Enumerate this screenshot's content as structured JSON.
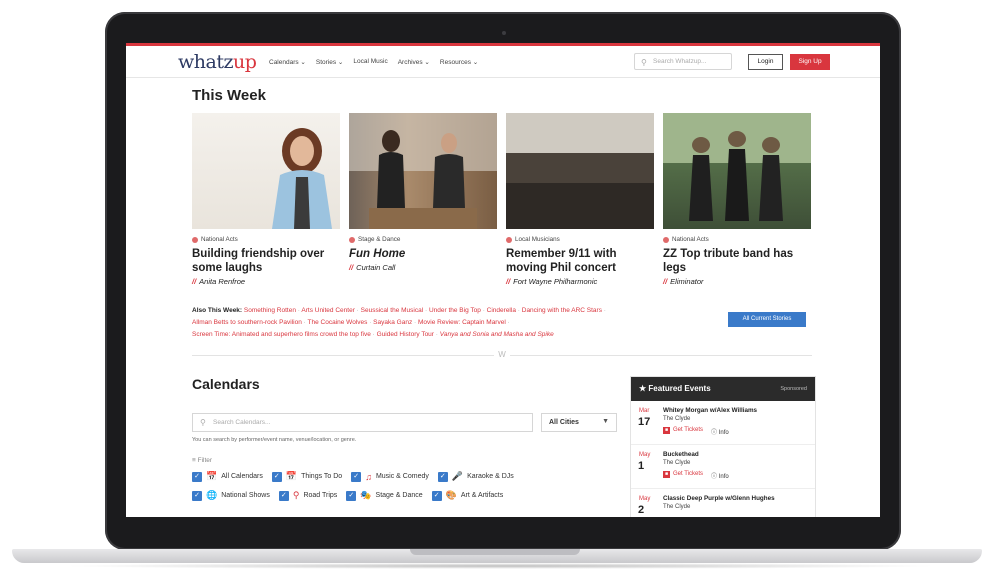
{
  "header": {
    "logo_main": "whatz",
    "logo_accent": "up",
    "nav": [
      "Calendars ⌄",
      "Stories ⌄",
      "Local Music",
      "Archives ⌄",
      "Resources ⌄"
    ],
    "search_placeholder": "Search Whatzup...",
    "login": "Login",
    "signup": "Sign Up"
  },
  "this_week": {
    "heading": "This Week",
    "cards": [
      {
        "category": "National Acts",
        "title": "Building friendship over some laughs",
        "subtitle": "Anita Renfroe",
        "italic": false
      },
      {
        "category": "Stage & Dance",
        "title": "Fun Home",
        "subtitle": "Curtain Call",
        "italic": true
      },
      {
        "category": "Local Musicians",
        "title": "Remember 9/11 with moving Phil concert",
        "subtitle": "Fort Wayne Philharmonic",
        "italic": false
      },
      {
        "category": "National Acts",
        "title": "ZZ Top tribute band has legs",
        "subtitle": "Eliminator",
        "italic": false
      }
    ]
  },
  "also": {
    "label": "Also This Week:",
    "line1": [
      "Something Rotten",
      "Arts United Center",
      "Seussical the Musical",
      "Under the Big Top",
      "Cinderella",
      "Dancing with the ARC Stars"
    ],
    "line2": [
      "Allman Betts to southern-rock Pavilion",
      "The Cocaine Wolves",
      "Sayaka Ganz",
      "Movie Review: Captain Marvel"
    ],
    "line3": [
      "Screen Time: Animated and superhero films crowd the top five",
      "Guided History Tour",
      "Vanya and Sonia and Masha and Spike"
    ],
    "button": "All Current Stories"
  },
  "divider_mark": "W",
  "calendars": {
    "heading": "Calendars",
    "search_placeholder": "Search Calendars...",
    "cities": "All Cities",
    "hint": "You can search by performer/event name, venue/location, or genre.",
    "filter": "Filter",
    "row1": [
      "All Calendars",
      "Things To Do",
      "Music & Comedy",
      "Karaoke & DJs"
    ],
    "row2": [
      "National Shows",
      "Road Trips",
      "Stage & Dance",
      "Art & Artifacts"
    ]
  },
  "featured": {
    "heading": "Featured Events",
    "sponsored": "Sponsored",
    "tickets_label": "Get Tickets",
    "info_label": "Info",
    "events": [
      {
        "month": "Mar",
        "day": "17",
        "name": "Whitey Morgan w/Alex Williams",
        "venue": "The Clyde"
      },
      {
        "month": "May",
        "day": "1",
        "name": "Buckethead",
        "venue": "The Clyde"
      },
      {
        "month": "May",
        "day": "2",
        "name": "Classic Deep Purple w/Glenn Hughes",
        "venue": "The Clyde"
      }
    ]
  }
}
